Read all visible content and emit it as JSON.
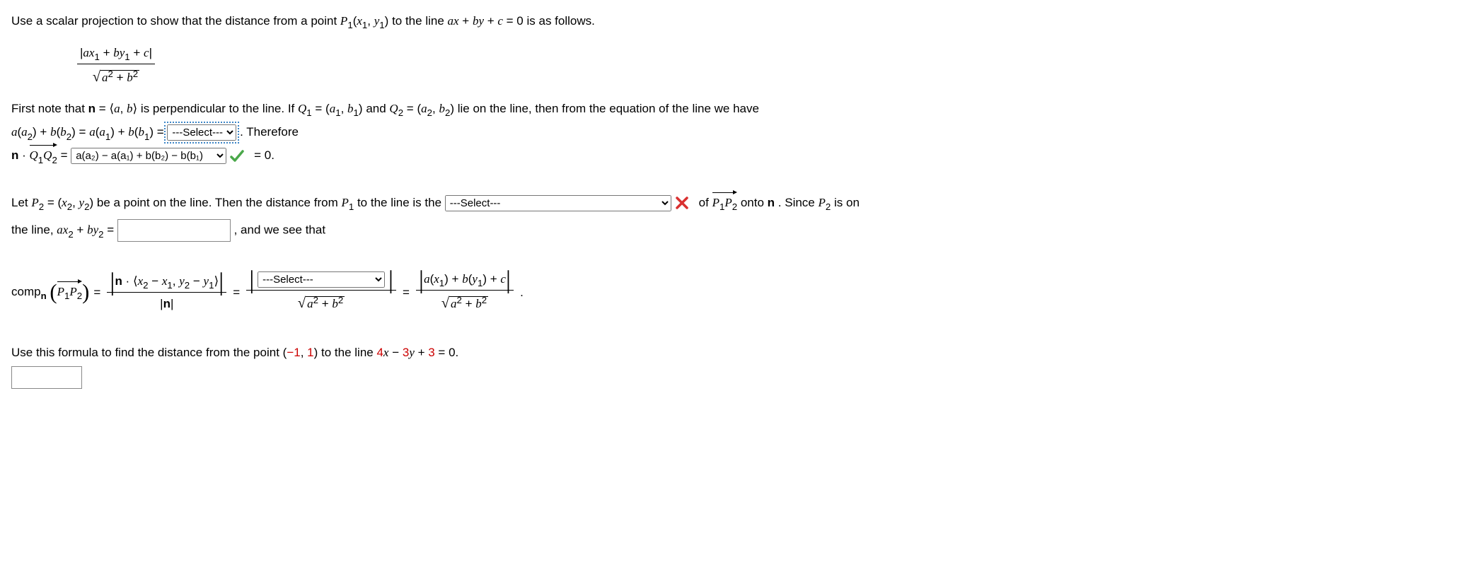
{
  "intro": "Use a scalar projection to show that the distance from a point ",
  "P1": "P",
  "paren_l": "(",
  "x1": "x",
  "comma": ", ",
  "y1": "y",
  "paren_r": ")",
  "intro2": " to the line ",
  "line_eq": "ax + by + c = 0",
  "intro3": " is as follows.",
  "frac_num": "|ax₁ + by₁ + c|",
  "frac_den_sqrt": "a² + b²",
  "para1_a": "First note that ",
  "n_bold": "n",
  "eq": " = ",
  "angle_l": "⟨",
  "ab": "a, b",
  "angle_r": "⟩",
  "para1_b": " is perpendicular to the line. If ",
  "Q1": "Q",
  "q1_tuple": "(a₁, b₁)",
  "and": " and ",
  "Q2": "Q",
  "q2_tuple": "(a₂, b₂)",
  "para1_c": " lie on the line, then from the equation of the line we have",
  "row2_lhs": "a(a₂) + b(b₂) = a(a₁) + b(b₁) = ",
  "row2_therefore": " Therefore",
  "select_placeholder": "---Select---",
  "row3_lhs_pre": " · ",
  "Q1Q2": "Q₁Q₂",
  "row3_eq0": " = 0.",
  "box_opt": "a(a₂) − a(a₁) + b(b₂) − b(b₁)",
  "para2_a": "Let ",
  "P2": "P",
  "p2_tuple": "(x₂, y₂)",
  "para2_b": " be a point on the line. Then the distance from ",
  "para2_c": " to the line is the ",
  "para2_d": " of ",
  "P1P2": "P₁P₂",
  "para2_e": " onto ",
  "para2_f": ". Since ",
  "para2_g": " is on",
  "row5_a": "the line, ",
  "row5_expr": "ax₂ + by₂ = ",
  "row5_b": " , and we see that",
  "comp_label": "comp",
  "comp_sub": "n",
  "big_eq": " = ",
  "mid_dot": " · ",
  "vec_inner": "x₂ − x₁, y₂ − y₁",
  "abs_n": "|n|",
  "sqrt_ab": "a² + b²",
  "final_num": "a(x₁) + b(y₁) + c",
  "period": ".",
  "final_para": "Use this formula to find the distance from the point (",
  "neg1": "−1",
  "comma2": ", ",
  "one": "1",
  "final_para2": ") to the line ",
  "final_eq": "4x − 3y + 3 = 0",
  "final_period": "."
}
